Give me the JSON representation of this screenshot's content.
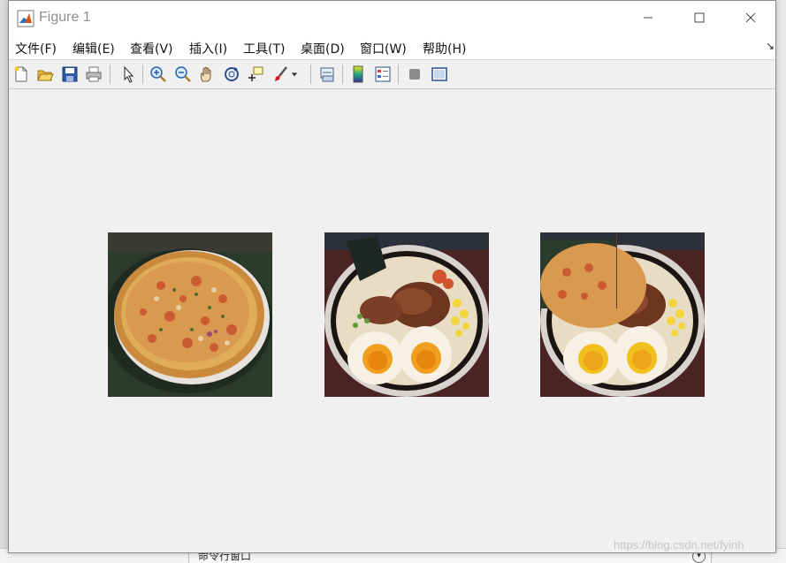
{
  "window": {
    "title": "Figure 1",
    "minimize_icon": "minimize-icon",
    "maximize_icon": "maximize-icon",
    "close_icon": "close-icon"
  },
  "menu": [
    {
      "label": "文件(F)"
    },
    {
      "label": "编辑(E)"
    },
    {
      "label": "查看(V)"
    },
    {
      "label": "插入(I)"
    },
    {
      "label": "工具(T)"
    },
    {
      "label": "桌面(D)"
    },
    {
      "label": "窗口(W)"
    },
    {
      "label": "帮助(H)"
    }
  ],
  "toolbar": [
    "new-figure-icon",
    "open-file-icon",
    "save-icon",
    "print-icon",
    "edit-plot-arrow-icon",
    "zoom-in-icon",
    "zoom-out-icon",
    "pan-hand-icon",
    "rotate-3d-icon",
    "data-cursor-icon",
    "brush-icon",
    "link-plot-icon",
    "colorbar-icon",
    "legend-icon",
    "hide-plot-tools-icon",
    "show-plot-tools-icon"
  ],
  "images": [
    {
      "name": "pizza-image",
      "subject": "pizza"
    },
    {
      "name": "ramen-image",
      "subject": "ramen"
    },
    {
      "name": "blended-image",
      "subject": "pizza-ramen-composite"
    }
  ],
  "desktop": {
    "command_window_label": "命令行窗口"
  },
  "watermark": "https://blog.csdn.net/fyinh",
  "colors": {
    "window_bg": "#f0f0f0",
    "titlebar_bg": "#ffffff",
    "title_text": "#8f8f8f"
  }
}
